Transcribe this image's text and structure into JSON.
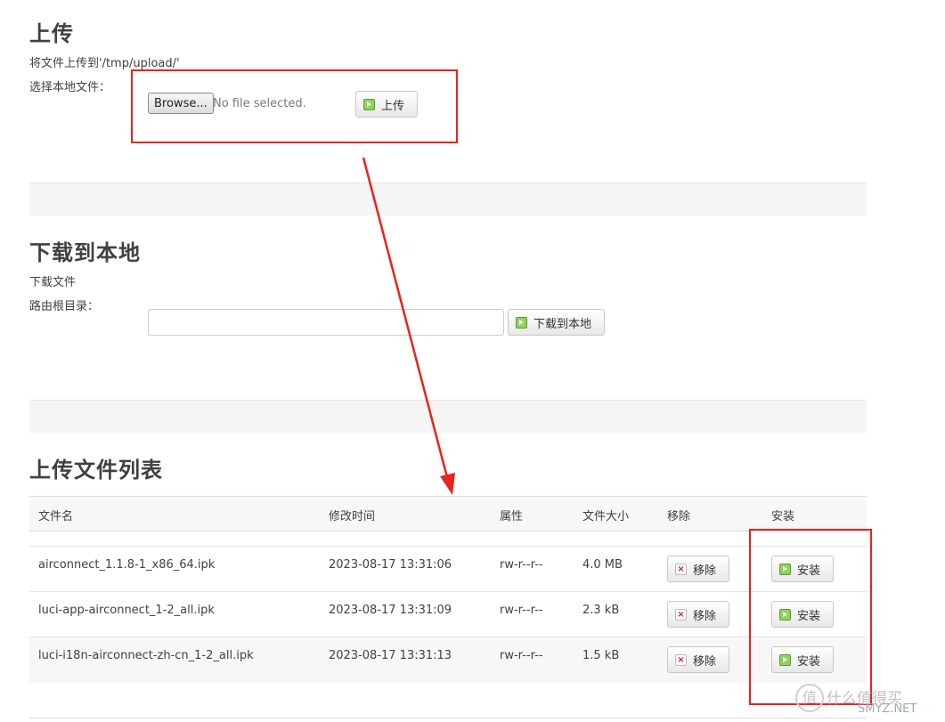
{
  "upload": {
    "title": "上传",
    "description": "将文件上传到'/tmp/upload/'",
    "choose_label": "选择本地文件：",
    "browse_label": "Browse...",
    "no_file_text": "No file selected.",
    "upload_button": "上传"
  },
  "download": {
    "title": "下载到本地",
    "description": "下载文件",
    "path_label": "路由根目录：",
    "path_value": "",
    "download_button": "下载到本地"
  },
  "file_list": {
    "title": "上传文件列表",
    "headers": [
      "文件名",
      "修改时间",
      "属性",
      "文件大小",
      "移除",
      "安装"
    ],
    "rows": [
      {
        "name": "airconnect_1.1.8-1_x86_64.ipk",
        "mtime": "2023-08-17 13:31:06",
        "attr": "rw-r--r--",
        "size": "4.0 MB",
        "remove": "移除",
        "install": "安装"
      },
      {
        "name": "luci-app-airconnect_1-2_all.ipk",
        "mtime": "2023-08-17 13:31:09",
        "attr": "rw-r--r--",
        "size": "2.3 kB",
        "remove": "移除",
        "install": "安装"
      },
      {
        "name": "luci-i18n-airconnect-zh-cn_1-2_all.ipk",
        "mtime": "2023-08-17 13:31:13",
        "attr": "rw-r--r--",
        "size": "1.5 kB",
        "remove": "移除",
        "install": "安装"
      }
    ]
  },
  "watermark": {
    "glyph": "值",
    "text": "什么值得买",
    "site": "SMYZ.NET"
  },
  "colors": {
    "annotation_red": "#e8231b",
    "apply_green": "#8fd25c",
    "remove_red": "#d02020"
  },
  "icons": {
    "apply": "apply-icon",
    "remove": "remove-icon"
  }
}
